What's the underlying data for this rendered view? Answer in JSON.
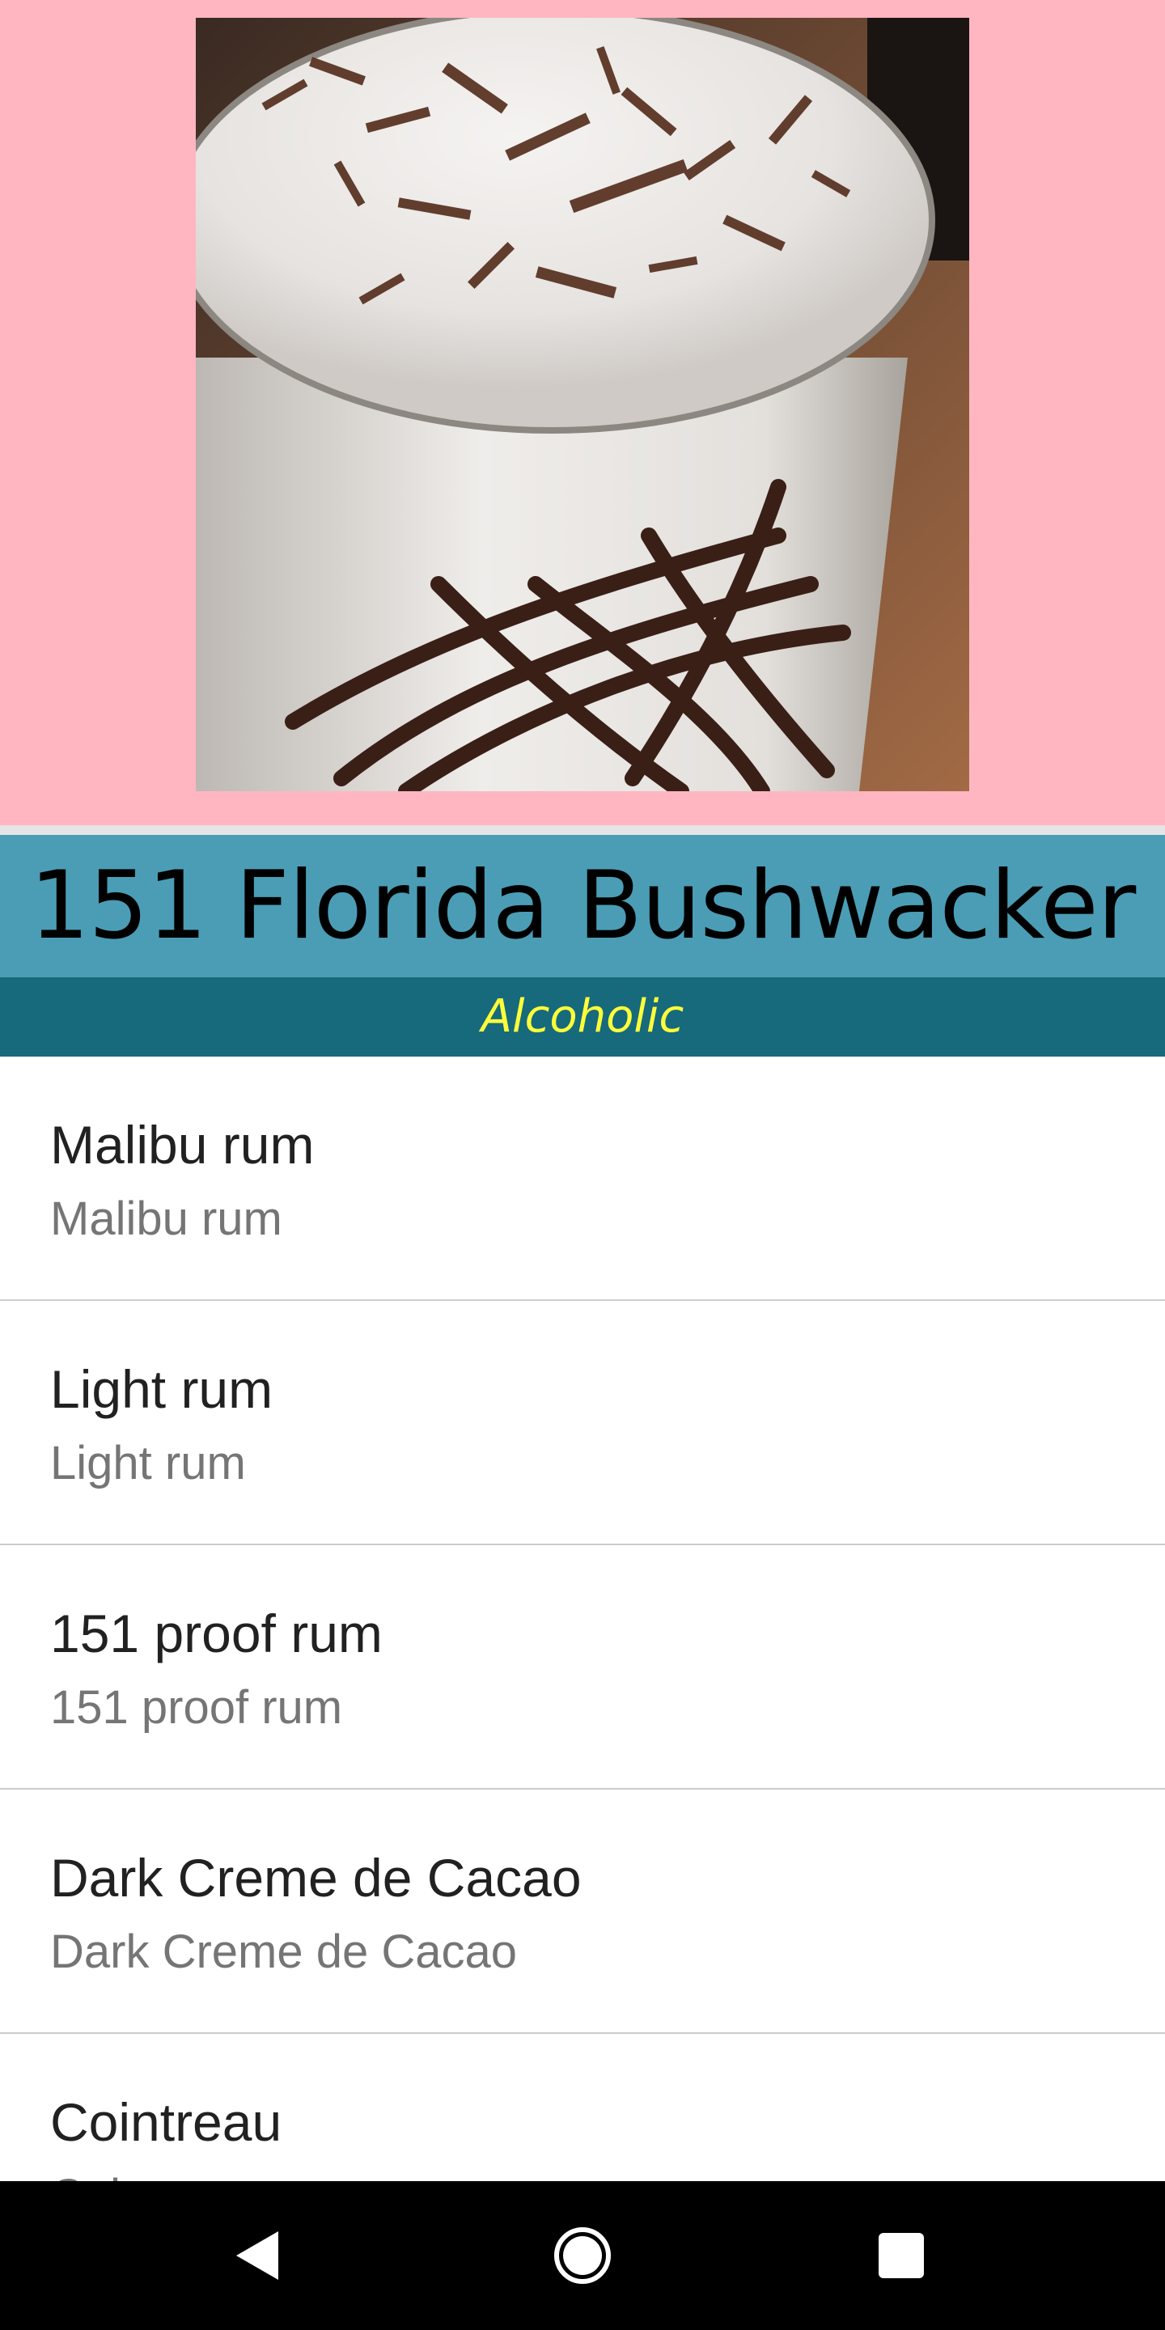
{
  "drink": {
    "image_alt": "Florida Bushwacker drink with chocolate shavings",
    "name": "151 Florida Bushwacker",
    "category": "Alcoholic"
  },
  "ingredients": [
    {
      "name": "Malibu rum",
      "measure": "Malibu rum"
    },
    {
      "name": "Light rum",
      "measure": "Light rum"
    },
    {
      "name": "151 proof rum",
      "measure": "151 proof rum"
    },
    {
      "name": "Dark Creme de Cacao",
      "measure": "Dark Creme de Cacao"
    },
    {
      "name": "Cointreau",
      "measure": "Cointreau"
    }
  ],
  "nav": {
    "back_icon": "back-triangle-icon",
    "home_icon": "home-circle-icon",
    "recents_icon": "recents-square-icon"
  },
  "colors": {
    "hero_background": "#FFB6C1",
    "title_background": "#4A9DB5",
    "subtitle_background": "#176A7C",
    "subtitle_text": "#FFFF3A",
    "nav_background": "#000000"
  }
}
